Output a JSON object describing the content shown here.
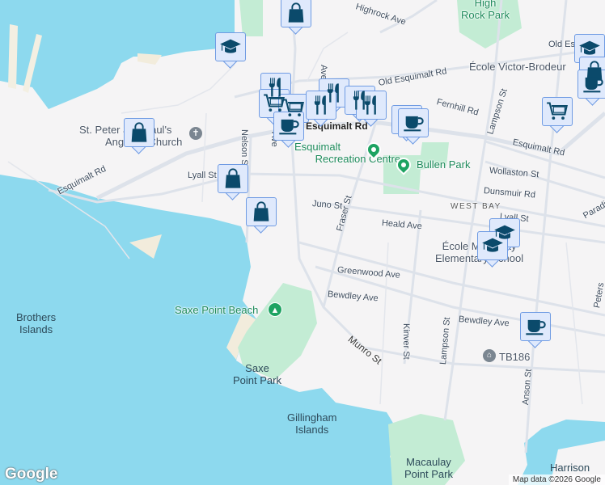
{
  "colors": {
    "water": "#8dd9ee",
    "land": "#f5f4f5",
    "park": "#c3ecd4",
    "marker_fill": "#dfe9fc",
    "marker_border": "#6f9be3",
    "icon": "#0b4a6b",
    "green_label": "#1e8a5b"
  },
  "labels": {
    "brothers_1": "Brothers",
    "brothers_2": "Islands",
    "church_1": "St. Peter and Paul's",
    "church_2": "Anglican Church",
    "esq_rd_w": "Esquimalt Rd",
    "lyall_w": "Lyall St",
    "nelson": "Nelson St",
    "ave1": "Ave",
    "ave2": "Ave",
    "esq_rd_c": "Esquimalt Rd",
    "old_esq": "Old Esquimalt Rd",
    "highrock": "Highrock Ave",
    "high_rock_1": "High",
    "high_rock_2": "Rock Park",
    "ecole_vb": "École Victor-Brodeur",
    "old_es_r": "Old Es",
    "fernhill": "Fernhill Rd",
    "lampson_n": "Lampson St",
    "esq_rd_e": "Esquimalt Rd",
    "rec_1": "Esquimalt",
    "rec_2": "Recreation Centre",
    "bullen": "Bullen Park",
    "wollaston": "Wollaston St",
    "dunsmuir": "Dunsmuir Rd",
    "west_bay": "WEST BAY",
    "lyall_e": "Lyall St",
    "paradise": "Paradi",
    "juno": "Juno St",
    "heald": "Heald Ave",
    "fraser": "Fraser St",
    "macaulay_school_1": "École Macaulay",
    "macaulay_school_2": "Elementary School",
    "greenwood": "Greenwood Ave",
    "bewdley_w": "Bewdley Ave",
    "bewdley_e": "Bewdley Ave",
    "lampson_s": "Lampson St",
    "kinver": "Kinver St",
    "munro": "Munro St",
    "anson": "Anson St",
    "peters": "Peters",
    "saxe_beach": "Saxe Point Beach",
    "saxe_park_1": "Saxe",
    "saxe_park_2": "Point Park",
    "gillingham_1": "Gillingham",
    "gillingham_2": "Islands",
    "macaulay_park_1": "Macaulay",
    "macaulay_park_2": "Point Park",
    "harrison": "Harrison",
    "tb186": "TB186"
  },
  "markers": [
    "shopping-bag",
    "school",
    "shopping-bag",
    "shopping-bag",
    "shopping-bag",
    "restaurant",
    "shopping-cart",
    "restaurant",
    "restaurant",
    "restaurant",
    "coffee",
    "coffee",
    "shopping-cart",
    "school",
    "coffee",
    "school",
    "school",
    "coffee"
  ],
  "footer": {
    "logo": "Google",
    "attribution": "Map data ©2026 Google"
  }
}
